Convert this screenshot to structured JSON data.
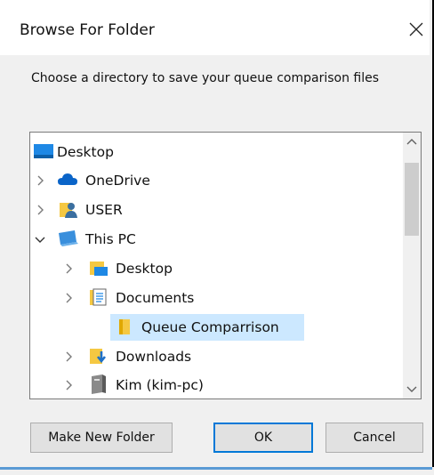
{
  "dialog": {
    "title": "Browse For Folder",
    "instruction": "Choose a directory to save your queue comparison files"
  },
  "tree": {
    "items": [
      {
        "label": "Desktop",
        "icon": "desktop-icon",
        "expander": "none"
      },
      {
        "label": "OneDrive",
        "icon": "cloud-icon",
        "expander": "collapsed"
      },
      {
        "label": "USER",
        "icon": "user-icon",
        "expander": "collapsed"
      },
      {
        "label": "This PC",
        "icon": "computer-icon",
        "expander": "expanded"
      },
      {
        "label": "Desktop",
        "icon": "desktop-folder-icon",
        "expander": "collapsed"
      },
      {
        "label": "Documents",
        "icon": "documents-icon",
        "expander": "collapsed"
      },
      {
        "label": "Queue Comparrison",
        "icon": "folder-icon",
        "expander": "none",
        "selected": true
      },
      {
        "label": "Downloads",
        "icon": "downloads-icon",
        "expander": "collapsed"
      },
      {
        "label": "Kim (kim-pc)",
        "icon": "network-drive-icon",
        "expander": "collapsed"
      }
    ]
  },
  "buttons": {
    "new_folder": "Make New Folder",
    "ok": "OK",
    "cancel": "Cancel"
  },
  "colors": {
    "selection": "#cce8ff",
    "folder": "#f5c842",
    "accent": "#1e90ff"
  }
}
